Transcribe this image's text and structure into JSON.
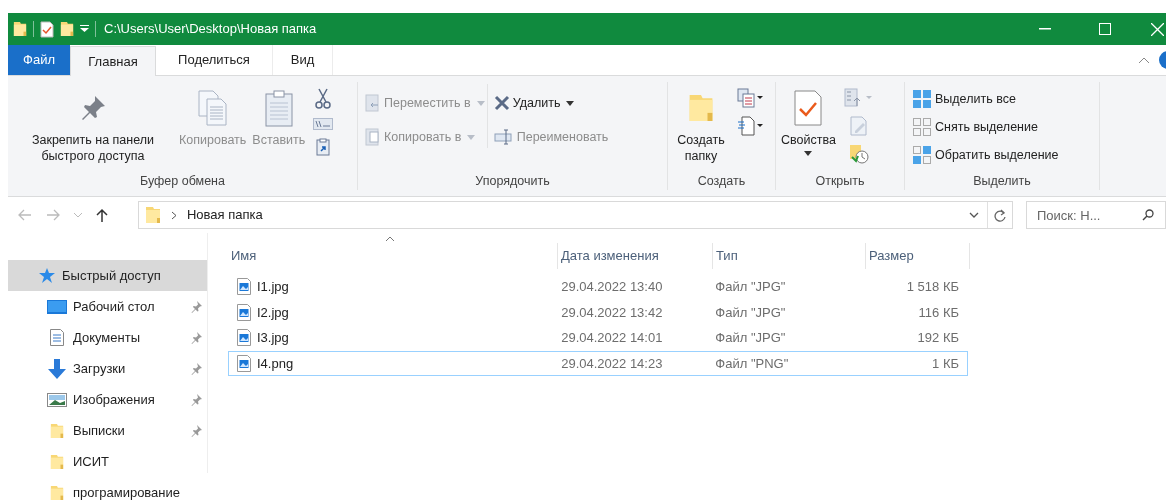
{
  "window": {
    "title": "C:\\Users\\User\\Desktop\\Новая папка"
  },
  "ribbon_tabs": [
    {
      "label": "Файл",
      "kind": "file",
      "selected": false
    },
    {
      "label": "Главная",
      "kind": "tab",
      "selected": true
    },
    {
      "label": "Поделиться",
      "kind": "tab",
      "selected": false
    },
    {
      "label": "Вид",
      "kind": "tab",
      "selected": false
    }
  ],
  "ribbon_groups": [
    {
      "title": "Буфер обмена",
      "items": [
        {
          "kind": "large",
          "label": "Закрепить на панели быстрого доступа",
          "disabled": false
        },
        {
          "kind": "large",
          "label": "Копировать",
          "disabled": true
        },
        {
          "kind": "large",
          "label": "Вставить",
          "disabled": true
        },
        {
          "kind": "icons"
        }
      ]
    },
    {
      "title": "Упорядочить",
      "items": [
        {
          "kind": "small",
          "label": "Переместить в",
          "disabled": true,
          "dropdown": true
        },
        {
          "kind": "small",
          "label": "Копировать в",
          "disabled": true,
          "dropdown": true
        },
        {
          "kind": "small",
          "label": "Удалить",
          "disabled": false,
          "dropdown": true
        },
        {
          "kind": "small",
          "label": "Переименовать",
          "disabled": true,
          "dropdown": false
        }
      ]
    },
    {
      "title": "Создать",
      "items": [
        {
          "kind": "large",
          "label": "Создать папку",
          "disabled": false
        },
        {
          "kind": "icons"
        }
      ]
    },
    {
      "title": "Открыть",
      "items": [
        {
          "kind": "large",
          "label": "Свойства",
          "disabled": false,
          "dropdown": true
        },
        {
          "kind": "icons"
        }
      ]
    },
    {
      "title": "Выделить",
      "items": [
        {
          "kind": "small",
          "label": "Выделить все",
          "disabled": false,
          "dropdown": false
        },
        {
          "kind": "small",
          "label": "Снять выделение",
          "disabled": false,
          "dropdown": false
        },
        {
          "kind": "small",
          "label": "Обратить выделение",
          "disabled": false,
          "dropdown": false
        }
      ]
    }
  ],
  "address": {
    "crumb": "Новая папка",
    "search_placeholder": "Поиск: Н..."
  },
  "sidebar": {
    "items": [
      {
        "label": "Быстрый доступ",
        "selected": true,
        "pinned": false,
        "children": [
          {
            "label": "Рабочий стол",
            "selected": false,
            "pinned": true
          },
          {
            "label": "Документы",
            "selected": false,
            "pinned": true
          },
          {
            "label": "Загрузки",
            "selected": false,
            "pinned": true
          },
          {
            "label": "Изображения",
            "selected": false,
            "pinned": true
          },
          {
            "label": "Выписки",
            "selected": false,
            "pinned": true
          },
          {
            "label": "ИСИТ",
            "selected": false,
            "pinned": false
          },
          {
            "label": "програмирование",
            "selected": false,
            "pinned": false
          }
        ]
      }
    ]
  },
  "table": {
    "columns": [
      {
        "label": "Имя",
        "sorted": true
      },
      {
        "label": "Дата изменения",
        "sorted": false
      },
      {
        "label": "Тип",
        "sorted": false
      },
      {
        "label": "Размер",
        "sorted": false
      }
    ],
    "rows": [
      {
        "name": "I1.jpg",
        "date": "29.04.2022 13:40",
        "type": "Файл \"JPG\"",
        "size": "1 518 КБ",
        "focused": false
      },
      {
        "name": "I2.jpg",
        "date": "29.04.2022 13:42",
        "type": "Файл \"JPG\"",
        "size": "116 КБ",
        "focused": false
      },
      {
        "name": "I3.jpg",
        "date": "29.04.2022 14:01",
        "type": "Файл \"JPG\"",
        "size": "192 КБ",
        "focused": false
      },
      {
        "name": "I4.png",
        "date": "29.04.2022 14:23",
        "type": "Файл \"PNG\"",
        "size": "1 КБ",
        "focused": true
      }
    ]
  }
}
